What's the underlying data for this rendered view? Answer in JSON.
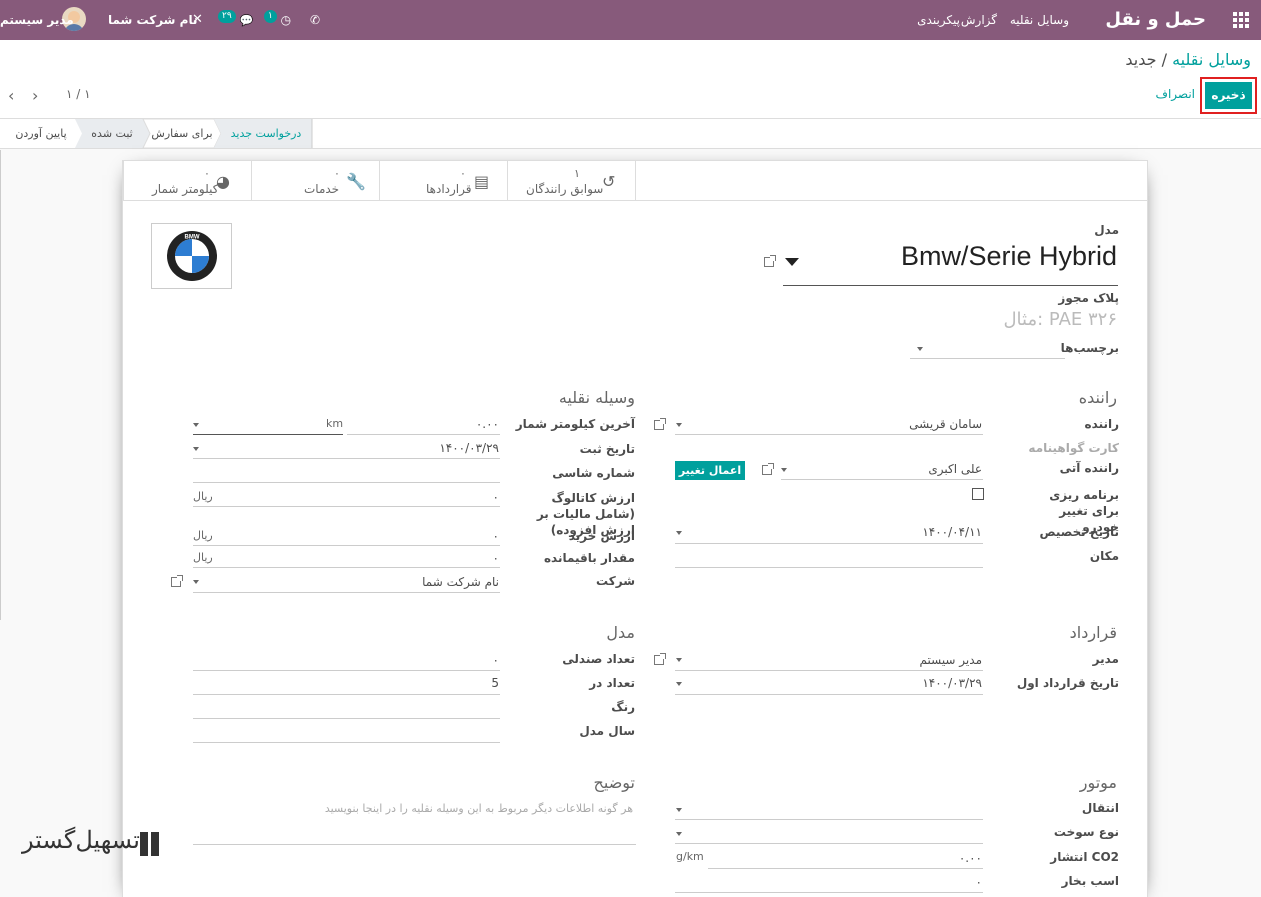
{
  "topbar": {
    "app_name": "حمل و نقل",
    "menu": [
      "وسایل نقلیه",
      "گزارش",
      "پیکربندی"
    ],
    "company": "نام شرکت شما",
    "user": "مدیر سیستم",
    "activity_count": "۱",
    "messages_count": "۲۹"
  },
  "breadcrumb": {
    "parent": "وسایل نقلیه",
    "separator": "/",
    "current": "جدید"
  },
  "buttons": {
    "save": "ذخیره",
    "discard": "انصراف"
  },
  "pager": {
    "value": "۱ / ۱"
  },
  "statusbar": {
    "stages": [
      "درخواست جدید",
      "برای سفارش",
      "ثبت شده",
      "پایین آوردن"
    ]
  },
  "smart_buttons": [
    {
      "label": "سوابق رانندگان",
      "count": "۱",
      "icon": "history-icon"
    },
    {
      "label": "قراردادها",
      "count": "۰",
      "icon": "book-icon"
    },
    {
      "label": "خدمات",
      "count": "۰",
      "icon": "wrench-icon"
    },
    {
      "label": "کیلومتر شمار",
      "count": "۰",
      "icon": "tachometer-icon"
    }
  ],
  "header": {
    "model_label": "مدل",
    "model_value": "Bmw/Serie Hybrid",
    "license_label": "پلاک مجوز",
    "license_placeholder": "مثال: PAE ۳۲۶",
    "tags_label": "برچسب‌ها",
    "logo_text": "BMW"
  },
  "driver": {
    "title": "راننده",
    "driver_label": "راننده",
    "driver_value": "سامان قریشی",
    "license_card_label": "کارت گواهینامه",
    "future_driver_label": "راننده آتی",
    "future_driver_value": "علی اکبری",
    "apply_change": "اعمال تغییر",
    "plan_change_label": "برنامه ریزی برای تغییر خودرو",
    "assignment_date_label": "تاریخ تخصیص",
    "assignment_date_value": "۱۴۰۰/۰۴/۱۱",
    "location_label": "مکان"
  },
  "vehicle": {
    "title": "وسیله نقلیه",
    "odometer_label": "آخرین کیلومتر شمار",
    "odometer_value": "۰.۰۰",
    "odometer_unit": "km",
    "reg_date_label": "تاریخ ثبت",
    "reg_date_value": "۱۴۰۰/۰۳/۲۹",
    "chassis_label": "شماره شاسی",
    "catalog_label": "ارزش کاتالوگ (شامل مالیات بر ارزش افزوده)",
    "catalog_value": "۰",
    "currency": "ریال",
    "purchase_label": "ارزش خرید",
    "purchase_value": "۰",
    "residual_label": "مقدار باقیمانده",
    "residual_value": "۰",
    "company_label": "شرکت",
    "company_value": "نام شرکت شما"
  },
  "contract": {
    "title": "قرارداد",
    "manager_label": "مدیر",
    "manager_value": "مدیر سیستم",
    "first_contract_label": "تاریخ قرارداد اول",
    "first_contract_value": "۱۴۰۰/۰۳/۲۹"
  },
  "model": {
    "title": "مدل",
    "seats_label": "تعداد صندلی",
    "seats_value": "۰",
    "doors_label": "تعداد در",
    "doors_value": "5",
    "color_label": "رنگ",
    "model_year_label": "سال مدل"
  },
  "engine": {
    "title": "موتور",
    "transmission_label": "انتقال",
    "fuel_label": "نوع سوخت",
    "co2_label": "انتشار CO2",
    "co2_value": "۰.۰۰",
    "co2_unit": "g/km",
    "horsepower_label": "اسب بخار",
    "horsepower_value": "۰"
  },
  "description": {
    "title": "توضیح",
    "placeholder": "هر گونه اطلاعات دیگر مربوط به این وسیله نقلیه را در اینجا بنویسید"
  },
  "watermark": "تسهیل‌گستر",
  "colors": {
    "primary": "#875a7b",
    "accent": "#00a09d",
    "highlight": "#e02020"
  }
}
